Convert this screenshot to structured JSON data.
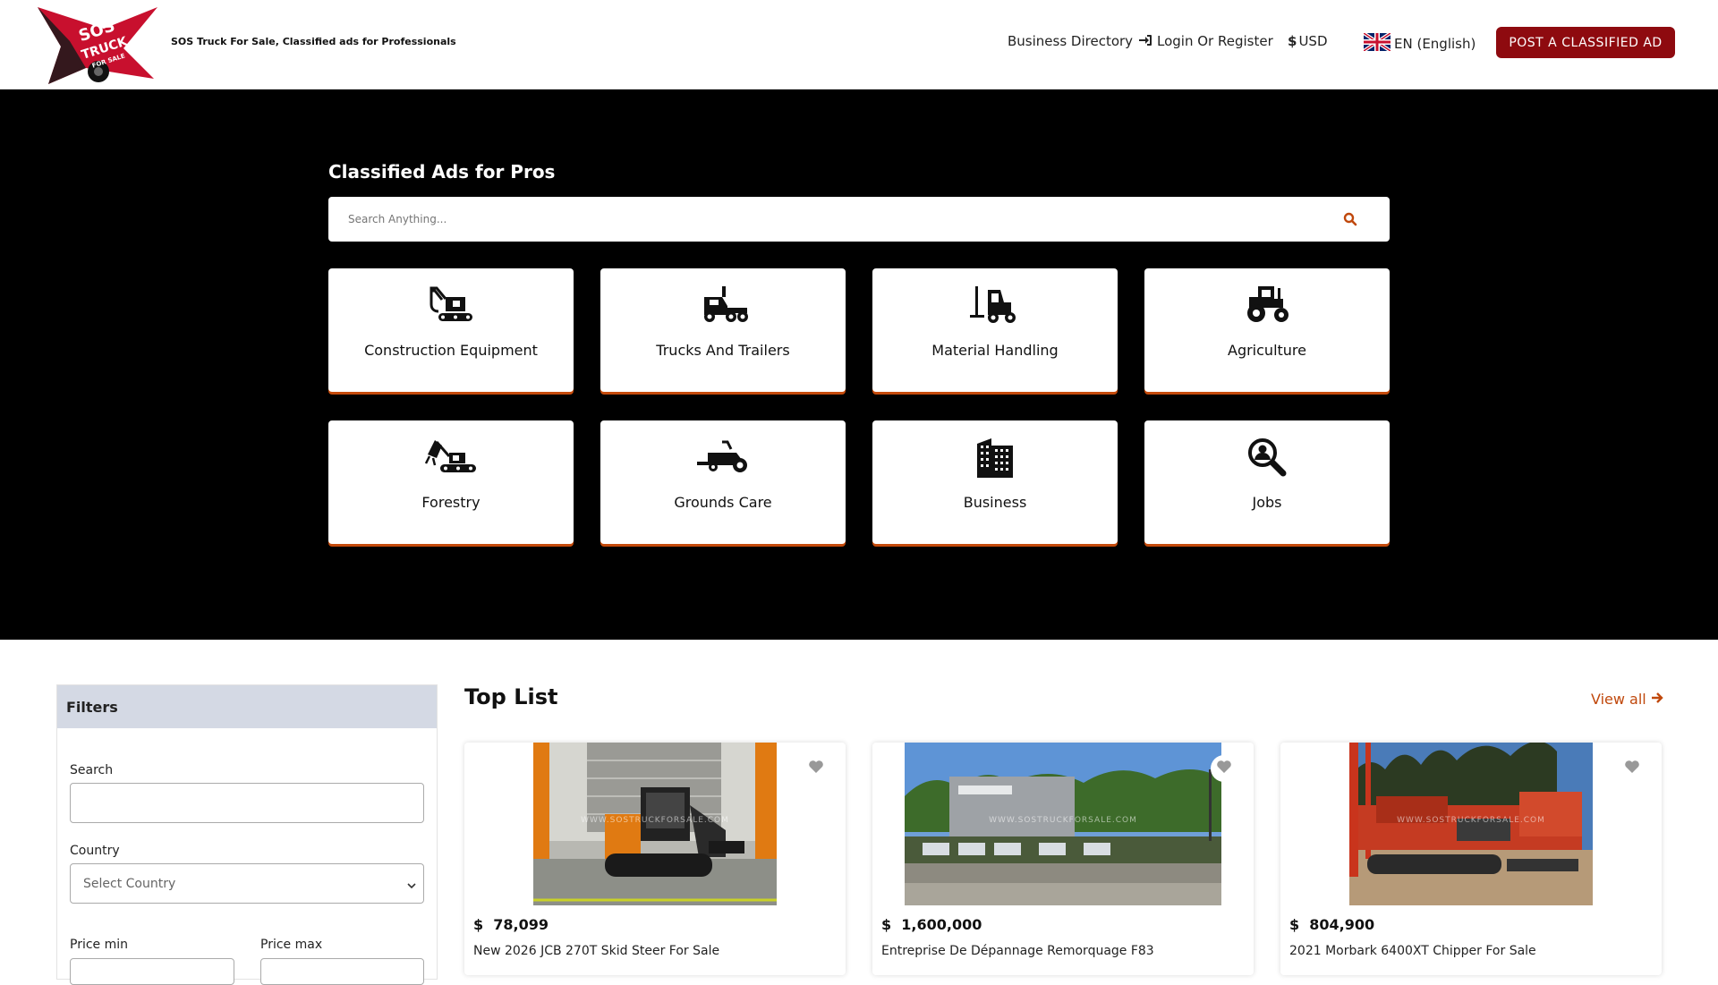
{
  "header": {
    "logo_text": "SOS TRUCK FOR SALE",
    "tagline": "SOS Truck For Sale, Classified ads for Professionals",
    "nav": {
      "business_directory": "Business Directory",
      "login": "Login Or Register",
      "currency": "USD",
      "language": "EN (English)"
    },
    "post_button": "POST A CLASSIFIED AD"
  },
  "hero": {
    "title": "Classified Ads for Pros",
    "search_placeholder": "Search Anything...",
    "categories": [
      {
        "label": "Construction Equipment",
        "icon": "excavator-icon"
      },
      {
        "label": "Trucks And Trailers",
        "icon": "truck-icon"
      },
      {
        "label": "Material Handling",
        "icon": "forklift-icon"
      },
      {
        "label": "Agriculture",
        "icon": "tractor-icon"
      },
      {
        "label": "Forestry",
        "icon": "forestry-machine-icon"
      },
      {
        "label": "Grounds Care",
        "icon": "lawn-mower-icon"
      },
      {
        "label": "Business",
        "icon": "building-icon"
      },
      {
        "label": "Jobs",
        "icon": "job-search-icon"
      }
    ]
  },
  "filters": {
    "title": "Filters",
    "search_label": "Search",
    "country_label": "Country",
    "country_placeholder": "Select Country",
    "price_min_label": "Price min",
    "price_max_label": "Price max"
  },
  "top_list": {
    "title": "Top List",
    "view_all": "View all",
    "listings": [
      {
        "currency": "$",
        "price": "78,099",
        "title": "New 2026 JCB 270T Skid Steer For Sale",
        "watermark": "WWW.SOSTRUCKFORSALE.COM"
      },
      {
        "currency": "$",
        "price": "1,600,000",
        "title": "Entreprise De Dépannage Remorquage F83",
        "watermark": "WWW.SOSTRUCKFORSALE.COM"
      },
      {
        "currency": "$",
        "price": "804,900",
        "title": "2021 Morbark 6400XT Chipper For Sale",
        "watermark": "WWW.SOSTRUCKFORSALE.COM"
      }
    ]
  },
  "colors": {
    "accent": "#8e0a0f",
    "card_underline": "#c44a0b",
    "link": "#c0480c",
    "hero_bg": "#000000"
  }
}
